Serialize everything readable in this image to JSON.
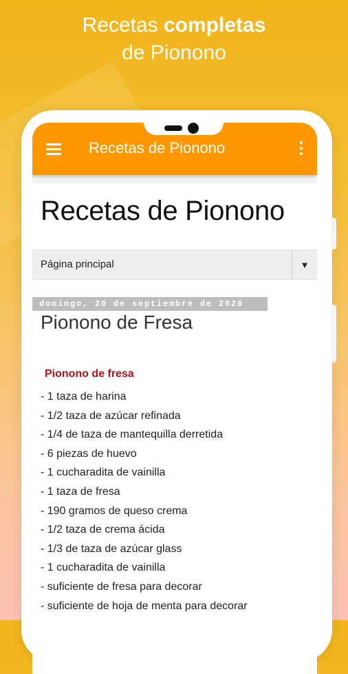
{
  "promo": {
    "line1_light": "Recetas",
    "line1_bold": "completas",
    "line2": "de Piononо"
  },
  "app": {
    "title": "Recetas de Piononо"
  },
  "blog": {
    "title": "Recetas de Piononо"
  },
  "nav": {
    "selected": "Página principal",
    "arrow": "▼"
  },
  "post": {
    "date": "domingo, 20 de septiembre de 2020",
    "title": "Pionono de Fresa",
    "section": "Pionono de fresa",
    "ingredients": [
      "- 1 taza de harina",
      "- 1/2 taza de azúcar refinada",
      "- 1/4 de taza de mantequilla derretida",
      "- 6 piezas de huevo",
      "- 1 cucharadita de vainilla",
      "- 1 taza de fresa",
      "- 190 gramos de queso crema",
      "- 1/2 taza de crema ácida",
      "- 1/3 de taza de azúcar glass",
      "- 1 cucharadita de vainilla",
      "- suficiente de fresa para decorar",
      "- suficiente de hoja de menta para decorar"
    ]
  }
}
